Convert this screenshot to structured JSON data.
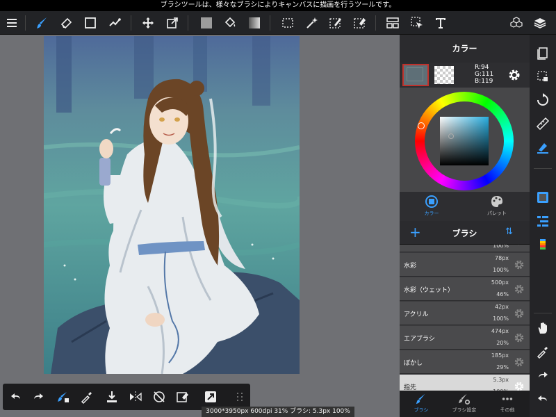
{
  "hint": "ブラシツールは、様々なブラシによりキャンバスに描画を行うツールです。",
  "toolbar": {
    "tools": [
      "menu-icon",
      "brush-icon",
      "eraser-icon",
      "shape-icon",
      "filter-brush-icon",
      "move-icon",
      "transform-icon",
      "fill-color-icon",
      "bucket-icon",
      "gradient-icon",
      "select-icon",
      "magic-wand-icon",
      "select-pen-icon",
      "select-eraser-icon",
      "layout-icon",
      "select-layer-icon",
      "text-icon",
      "material-icon",
      "layers-icon"
    ],
    "active_tool": "brush-icon"
  },
  "panel": {
    "color_title": "カラー",
    "main_color": "#5e6f77",
    "rgb": {
      "r": "R:94",
      "g": "G:111",
      "b": "B:119"
    },
    "modes": [
      {
        "label": "カラー",
        "icon": "color-circle-icon",
        "active": true
      },
      {
        "label": "パレット",
        "icon": "palette-icon",
        "active": false
      }
    ],
    "brush_title": "ブラシ",
    "brushes": [
      {
        "name": "",
        "size": "",
        "opacity": "100%",
        "selected": false
      },
      {
        "name": "水彩",
        "size": "78px",
        "opacity": "100%",
        "selected": false
      },
      {
        "name": "水彩（ウェット）",
        "size": "500px",
        "opacity": "46%",
        "selected": false
      },
      {
        "name": "アクリル",
        "size": "42px",
        "opacity": "100%",
        "selected": false
      },
      {
        "name": "エアブラシ",
        "size": "474px",
        "opacity": "20%",
        "selected": false
      },
      {
        "name": "ぼかし",
        "size": "185px",
        "opacity": "29%",
        "selected": false
      },
      {
        "name": "指先",
        "size": "5.3px",
        "opacity": "100%",
        "selected": true
      }
    ],
    "tabs": [
      {
        "label": "ブラシ",
        "icon": "brush-icon",
        "active": true
      },
      {
        "label": "ブラシ設定",
        "icon": "brush-settings-icon",
        "active": false
      },
      {
        "label": "その他",
        "icon": "more-icon",
        "active": false
      }
    ]
  },
  "status": "3000*3950px 600dpi 31% ブラシ: 5.3px 100%",
  "accent": "#3aa0ff"
}
